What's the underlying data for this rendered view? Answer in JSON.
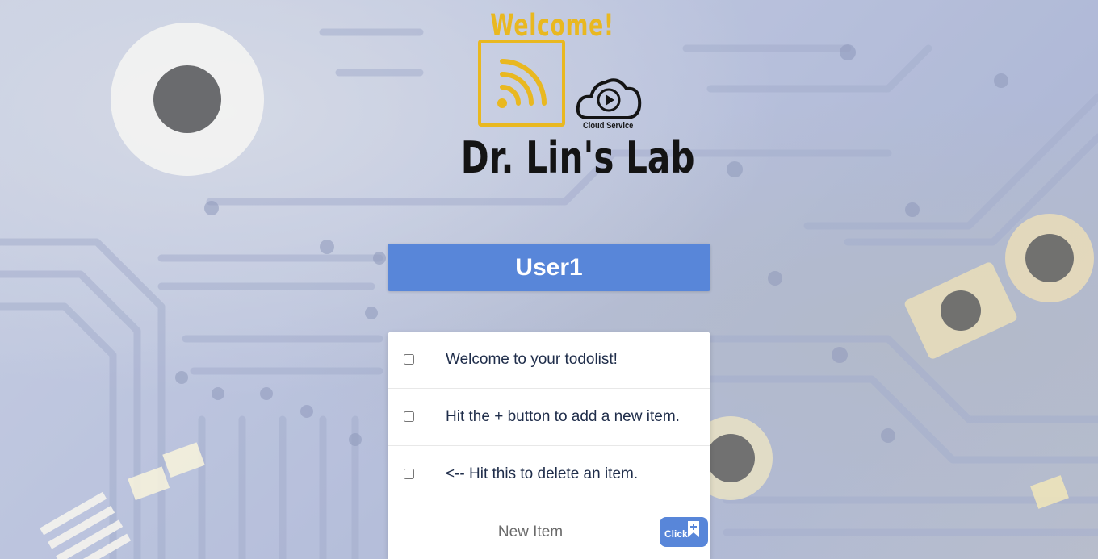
{
  "logo": {
    "welcome": "Welcome!",
    "lab_name": "Dr. Lin's Lab",
    "cloud_caption": "Cloud Service",
    "icons": [
      "wifi-signal-icon",
      "cloud-play-icon"
    ],
    "accent_color": "#e9b820"
  },
  "list": {
    "title": "User1",
    "header_color": "#5886d9",
    "items": [
      {
        "text": "Welcome to your todolist!",
        "checked": false
      },
      {
        "text": "Hit the + button to add a new item.",
        "checked": false
      },
      {
        "text": "<-- Hit this to delete an item.",
        "checked": false
      }
    ]
  },
  "new_item": {
    "placeholder": "New Item",
    "value": "",
    "button_label": "Click",
    "button_icon": "bookmark-plus-icon"
  }
}
